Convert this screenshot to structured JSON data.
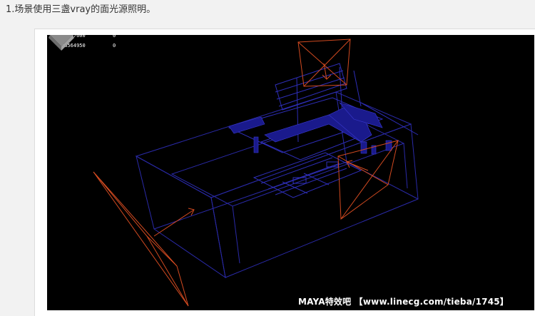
{
  "caption": "1.场景使用三盏vray的面光源照明。",
  "viewport": {
    "stats": [
      {
        "value": "10407600",
        "count": "0"
      },
      {
        "value": "16564950",
        "count": "0"
      }
    ],
    "watermark": "MAYA特效吧 【www.linecg.com/tieba/1745】",
    "colors": {
      "background": "#000000",
      "geometry": "#2a2aa8",
      "lights": "#d24a20"
    },
    "icons": [
      "view-cube-icon"
    ]
  }
}
